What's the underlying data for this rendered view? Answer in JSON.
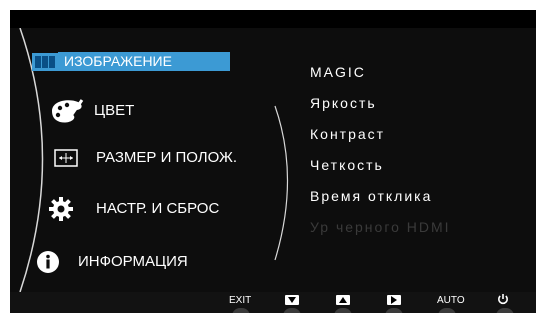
{
  "main_menu": [
    {
      "id": "picture",
      "label": "ИЗОБРАЖЕНИЕ",
      "icon": "picture-icon",
      "selected": true
    },
    {
      "id": "color",
      "label": "ЦВЕТ",
      "icon": "palette-icon"
    },
    {
      "id": "size",
      "label": "РАЗМЕР И ПОЛОЖ.",
      "icon": "size-position-icon"
    },
    {
      "id": "setup",
      "label": "НАСТР. И СБРОС",
      "icon": "gear-icon"
    },
    {
      "id": "info",
      "label": "ИНФОРМАЦИЯ",
      "icon": "info-icon"
    }
  ],
  "submenu": [
    {
      "label": "MAGIC",
      "enabled": true
    },
    {
      "label": "Яркость",
      "enabled": true
    },
    {
      "label": "Контраст",
      "enabled": true
    },
    {
      "label": "Четкость",
      "enabled": true
    },
    {
      "label": "Время отклика",
      "enabled": true
    },
    {
      "label": "Ур черного HDMI",
      "enabled": false
    }
  ],
  "buttons": {
    "exit": "EXIT",
    "down": "down-arrow-icon",
    "up": "up-arrow-icon",
    "enter": "right-arrow-icon",
    "auto": "AUTO",
    "power": "power-icon"
  },
  "colors": {
    "highlight": "#3c9ad4",
    "disabled_text": "#3a3a3a",
    "background": "#0d0d0d"
  }
}
